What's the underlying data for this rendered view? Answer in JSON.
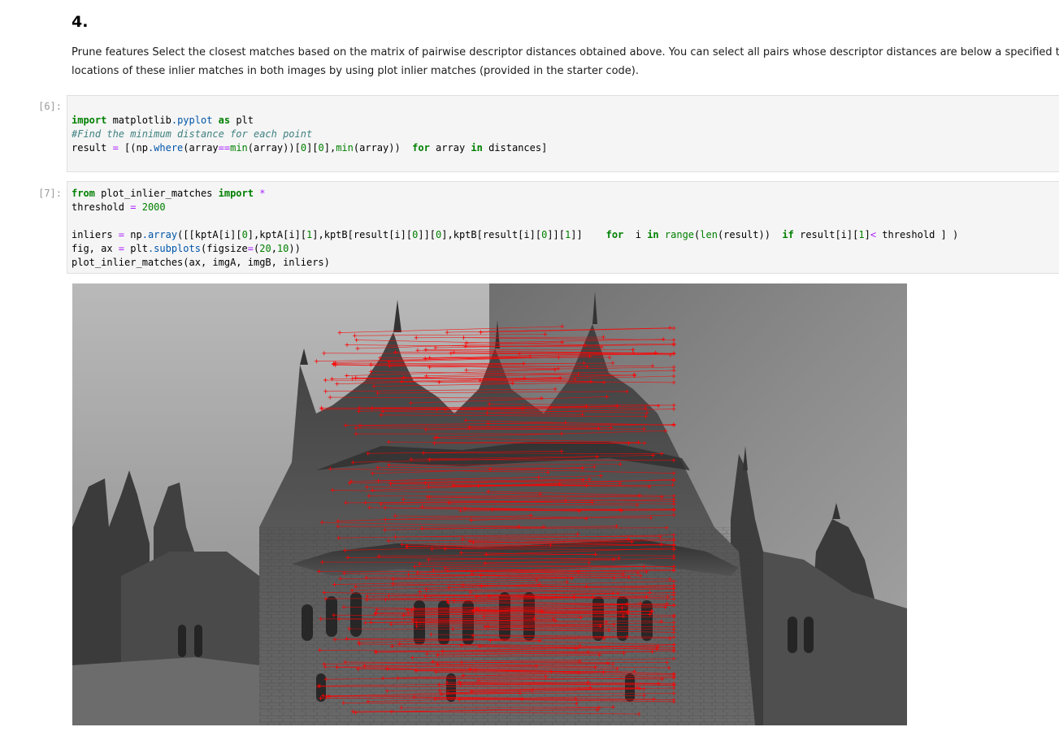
{
  "markdown": {
    "heading": "4.",
    "paragraph_line1": "Prune features Select the closest matches based on the matrix of pairwise descriptor distances obtained above. You can select all pairs whose descriptor distances are below a specified threshold, or",
    "paragraph_line2": "locations of these inlier matches in both images by using plot inlier matches (provided in the starter code)."
  },
  "cells": [
    {
      "prompt": "[6]:",
      "lines": [
        [
          {
            "t": "import",
            "c": "kw"
          },
          {
            "t": " matplotlib"
          },
          {
            "t": ".pyplot",
            "c": "attr"
          },
          {
            "t": " "
          },
          {
            "t": "as",
            "c": "kw"
          },
          {
            "t": " plt"
          }
        ],
        [
          {
            "t": "#Find the minimum distance for each point",
            "c": "cm"
          }
        ],
        [
          {
            "t": "result "
          },
          {
            "t": "=",
            "c": "op"
          },
          {
            "t": " [(np"
          },
          {
            "t": ".where",
            "c": "attr"
          },
          {
            "t": "(array"
          },
          {
            "t": "==",
            "c": "op"
          },
          {
            "t": "min",
            "c": "nb"
          },
          {
            "t": "(array))["
          },
          {
            "t": "0",
            "c": "num"
          },
          {
            "t": "]["
          },
          {
            "t": "0",
            "c": "num"
          },
          {
            "t": "],"
          },
          {
            "t": "min",
            "c": "nb"
          },
          {
            "t": "(array))  "
          },
          {
            "t": "for",
            "c": "kw"
          },
          {
            "t": " array "
          },
          {
            "t": "in",
            "c": "kw"
          },
          {
            "t": " distances]"
          }
        ]
      ]
    },
    {
      "prompt": "[7]:",
      "lines": [
        [
          {
            "t": "from",
            "c": "kw"
          },
          {
            "t": " plot_inlier_matches "
          },
          {
            "t": "import",
            "c": "kw"
          },
          {
            "t": " "
          },
          {
            "t": "*",
            "c": "op"
          }
        ],
        [
          {
            "t": "threshold "
          },
          {
            "t": "=",
            "c": "op"
          },
          {
            "t": " "
          },
          {
            "t": "2000",
            "c": "num"
          }
        ],
        [],
        [
          {
            "t": "inliers "
          },
          {
            "t": "=",
            "c": "op"
          },
          {
            "t": " np"
          },
          {
            "t": ".array",
            "c": "attr"
          },
          {
            "t": "([[kptA[i]["
          },
          {
            "t": "0",
            "c": "num"
          },
          {
            "t": "],kptA[i]["
          },
          {
            "t": "1",
            "c": "num"
          },
          {
            "t": "],kptB[result[i]["
          },
          {
            "t": "0",
            "c": "num"
          },
          {
            "t": "]]["
          },
          {
            "t": "0",
            "c": "num"
          },
          {
            "t": "],kptB[result[i]["
          },
          {
            "t": "0",
            "c": "num"
          },
          {
            "t": "]]["
          },
          {
            "t": "1",
            "c": "num"
          },
          {
            "t": "]]    "
          },
          {
            "t": "for",
            "c": "kw"
          },
          {
            "t": "  i "
          },
          {
            "t": "in",
            "c": "kw"
          },
          {
            "t": " "
          },
          {
            "t": "range",
            "c": "nb"
          },
          {
            "t": "("
          },
          {
            "t": "len",
            "c": "nb"
          },
          {
            "t": "(result))  "
          },
          {
            "t": "if",
            "c": "kw"
          },
          {
            "t": " result[i]["
          },
          {
            "t": "1",
            "c": "num"
          },
          {
            "t": "]"
          },
          {
            "t": "<",
            "c": "op"
          },
          {
            "t": " threshold ] )"
          }
        ],
        [
          {
            "t": "fig, ax "
          },
          {
            "t": "=",
            "c": "op"
          },
          {
            "t": " plt"
          },
          {
            "t": ".subplots",
            "c": "attr"
          },
          {
            "t": "(figsize"
          },
          {
            "t": "=",
            "c": "op"
          },
          {
            "t": "("
          },
          {
            "t": "20",
            "c": "num"
          },
          {
            "t": ","
          },
          {
            "t": "10",
            "c": "num"
          },
          {
            "t": "))"
          }
        ],
        [
          {
            "t": "plot_inlier_matches(ax, imgA, imgB, inliers)"
          }
        ]
      ]
    }
  ],
  "output": {
    "sky_color": "#8a8a8a",
    "building_color": "#4f4f4f",
    "match_color": "#ff0000",
    "match_count": 260
  }
}
